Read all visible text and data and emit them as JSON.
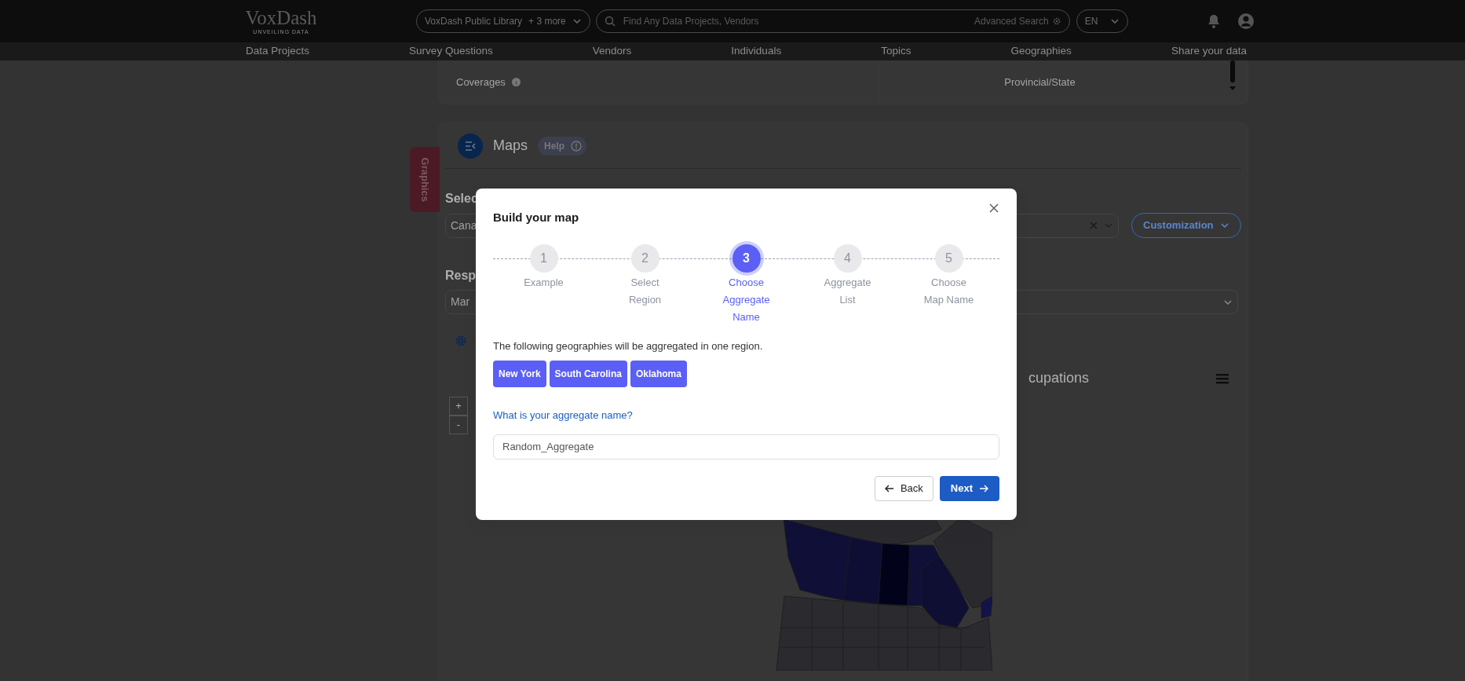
{
  "navbar": {
    "logo": "VoxDash",
    "logo_tagline": "UNVEILING DATA",
    "library_selector": {
      "label": "VoxDash Public Library",
      "more": "+ 3 more"
    },
    "search": {
      "placeholder": "Find Any Data Projects, Vendors",
      "advanced": "Advanced Search"
    },
    "language": "EN",
    "nav_items": [
      "Data Projects",
      "Survey Questions",
      "Vendors",
      "Individuals",
      "Topics",
      "Geographies",
      "Share your data"
    ]
  },
  "coverage_card": {
    "label": "Coverages",
    "value": "Provincial/State"
  },
  "maps_panel": {
    "side_tab": "Graphics",
    "title": "Maps",
    "help": "Help",
    "select_label": "Selec",
    "select_value": "Cana",
    "customization": "Customization",
    "response_label": "Resp",
    "response_value": "Mar",
    "chart_title": "cupations",
    "zoom_in": "+",
    "zoom_out": "-"
  },
  "modal": {
    "title": "Build your map",
    "steps": [
      {
        "number": "1",
        "label_lines": [
          "Example"
        ],
        "selected": false
      },
      {
        "number": "2",
        "label_lines": [
          "Select",
          "Region"
        ],
        "selected": false
      },
      {
        "number": "3",
        "label_lines": [
          "Choose",
          "Aggregate",
          "Name"
        ],
        "selected": true
      },
      {
        "number": "4",
        "label_lines": [
          "Aggregate",
          "List"
        ],
        "selected": false
      },
      {
        "number": "5",
        "label_lines": [
          "Choose",
          "Map Name"
        ],
        "selected": false
      }
    ],
    "intro": "The following geographies will be aggregated in one region.",
    "geographies": [
      "New York",
      "South Carolina",
      "Oklahoma"
    ],
    "question": "What is your aggregate name?",
    "name_value": "Random_Aggregate",
    "back": "Back",
    "next": "Next"
  }
}
